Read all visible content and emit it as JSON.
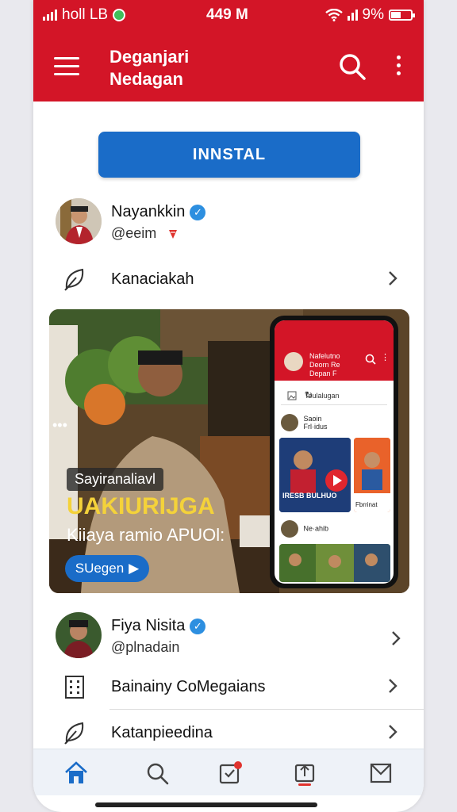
{
  "status_bar": {
    "carrier": "holl LB",
    "time": "449 M",
    "battery": "9%"
  },
  "app_bar": {
    "title_line1": "Deganjari",
    "title_line2": "Nedagan",
    "menu_icon": "hamburger-icon",
    "search_icon": "search-icon",
    "more_icon": "kebab-icon"
  },
  "install_button": {
    "label": "INNSTAL"
  },
  "profile1": {
    "name": "Nayankkin",
    "handle": "@eeim"
  },
  "row1": {
    "label": "Kanaciakah"
  },
  "banner": {
    "chip": "Sayiranaliavl",
    "headline": "UAKIURIJGA",
    "subtitle": "Kiiaya ramio APUOl:",
    "cta": "SUegen",
    "mini_title_line1": "Nafelutno",
    "mini_title_line2": "Deorn Re",
    "mini_title_line3": "Depan F",
    "mini_search": "Toulalugan",
    "mini_row1_name": "Saoin",
    "mini_row1_sub": "Frl·idus",
    "mini_card_text": "IRESB BULHUO",
    "mini_card_sub": "Fbrrinat",
    "mini_row2_name": "Ne·ahib"
  },
  "profile2": {
    "name": "Fiya Nisita",
    "handle": "@plnadain"
  },
  "row2": {
    "label": "Bainainy CoMegaians"
  },
  "row3": {
    "label": "Katanpieedina"
  },
  "bottom_nav": {
    "items": [
      "home-icon",
      "search-icon",
      "notifications-icon",
      "repost-icon",
      "mail-icon"
    ],
    "active_color": "#1a6cc8",
    "badge_color": "#e0332e"
  },
  "colors": {
    "brand": "#d31527",
    "accent": "#1a6cc8",
    "headline": "#f4d23a"
  }
}
